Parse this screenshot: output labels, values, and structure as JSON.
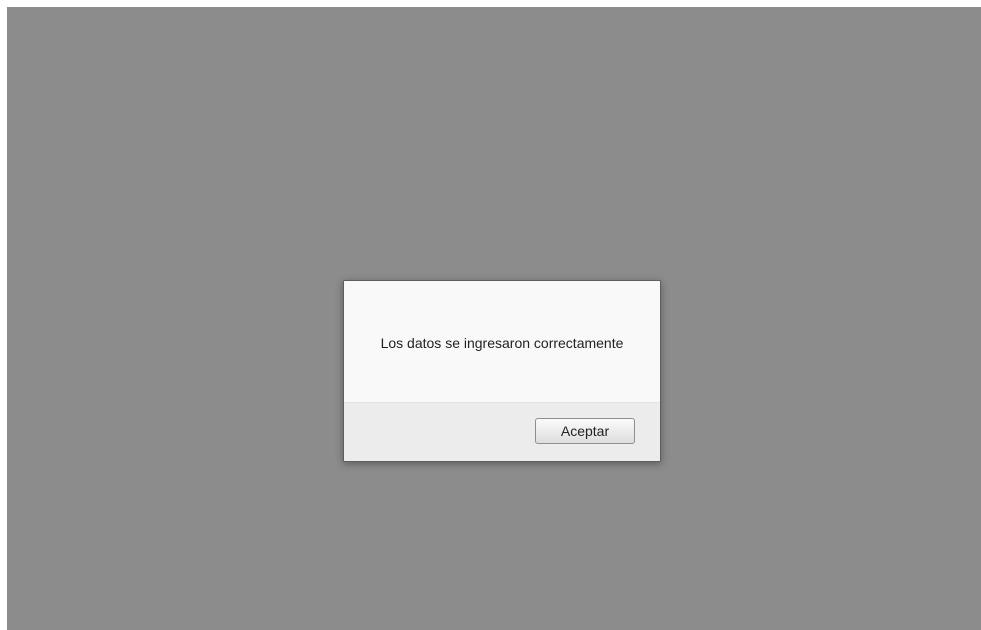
{
  "dialog": {
    "message": "Los datos se ingresaron correctamente",
    "ok_label": "Aceptar"
  },
  "colors": {
    "overlay": "#8c8c8c",
    "dialog_body": "#f9f9f9",
    "dialog_footer": "#ececec"
  }
}
